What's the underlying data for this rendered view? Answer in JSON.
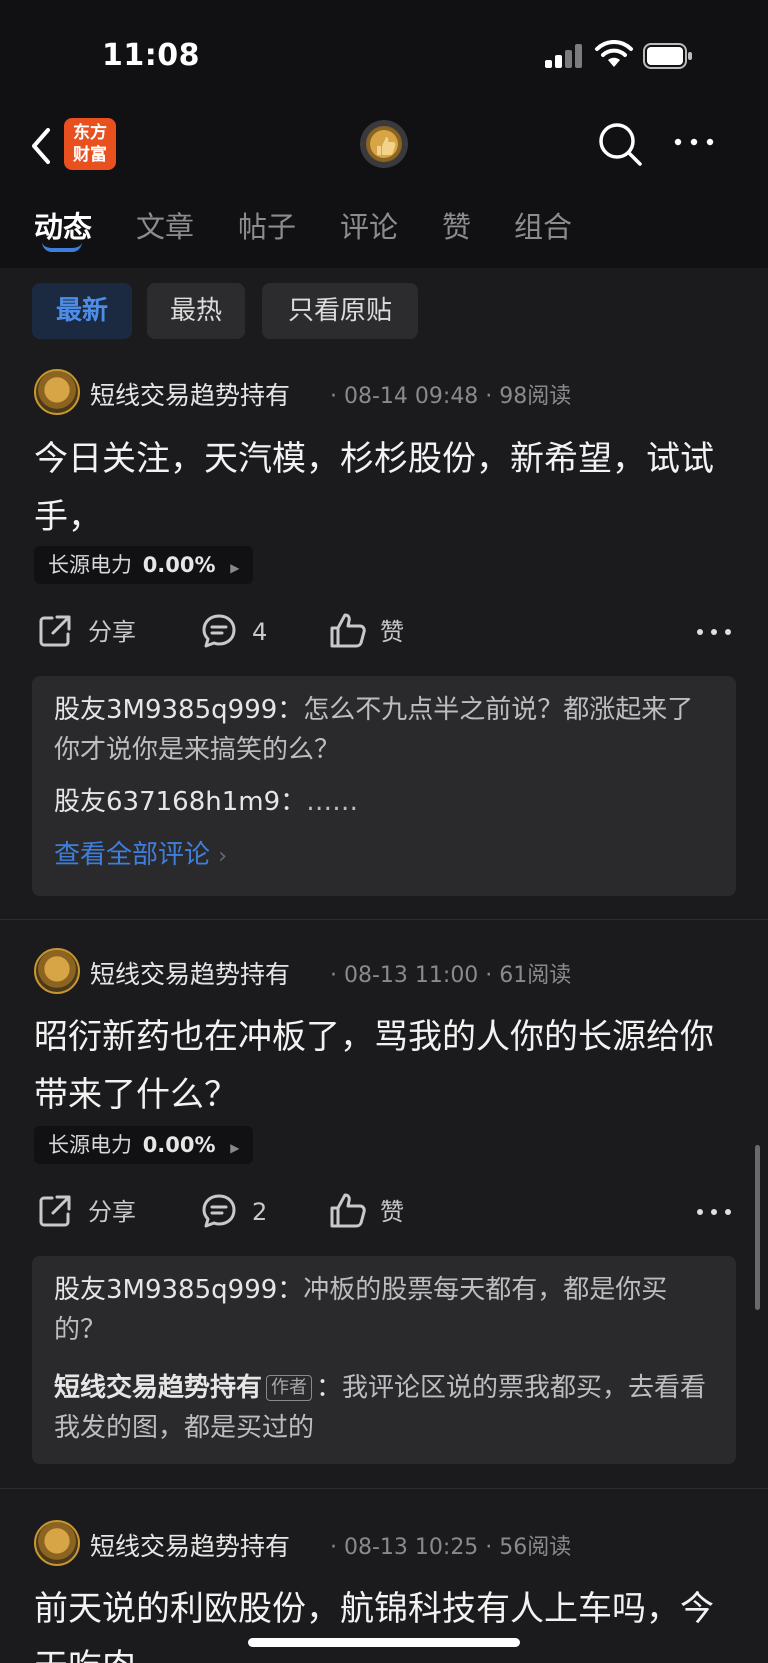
{
  "status": {
    "time": "11:08"
  },
  "nav": {
    "logo_text": "东方\n财富"
  },
  "tabs": [
    {
      "label": "动态",
      "active": true
    },
    {
      "label": "文章"
    },
    {
      "label": "帖子"
    },
    {
      "label": "评论"
    },
    {
      "label": "赞"
    },
    {
      "label": "组合"
    }
  ],
  "filters": [
    {
      "label": "最新",
      "active": true
    },
    {
      "label": "最热"
    },
    {
      "label": "只看原贴"
    }
  ],
  "posts": [
    {
      "author": "短线交易趋势持有",
      "meta": "· 08-14 09:48 · 98阅读",
      "text": "今日关注，天汽模，杉杉股份，新希望，试试手，",
      "stock_name": "长源电力",
      "stock_change": "0.00%",
      "share_label": "分享",
      "comment_count": "4",
      "like_label": "赞",
      "comments": [
        {
          "user": "股友3M9385q999：",
          "text": "怎么不九点半之前说？都涨起来了你才说你是来搞笑的么？"
        },
        {
          "user": "股友637168h1m9：",
          "text": "……"
        }
      ],
      "view_all": "查看全部评论"
    },
    {
      "author": "短线交易趋势持有",
      "meta": "· 08-13 11:00 · 61阅读",
      "text": "昭衍新药也在冲板了，骂我的人你的长源给你带来了什么？",
      "stock_name": "长源电力",
      "stock_change": "0.00%",
      "share_label": "分享",
      "comment_count": "2",
      "like_label": "赞",
      "comments": [
        {
          "user": "股友3M9385q999：",
          "text": "冲板的股票每天都有，都是你买的？"
        },
        {
          "user": "短线交易趋势持有",
          "badge": "作者",
          "sep": "：",
          "text": "我评论区说的票我都买，去看看我发的图，都是买过的"
        }
      ]
    },
    {
      "author": "短线交易趋势持有",
      "meta": "· 08-13 10:25 · 56阅读",
      "text": "前天说的利欧股份，航锦科技有人上车吗，今天吃肉"
    }
  ]
}
